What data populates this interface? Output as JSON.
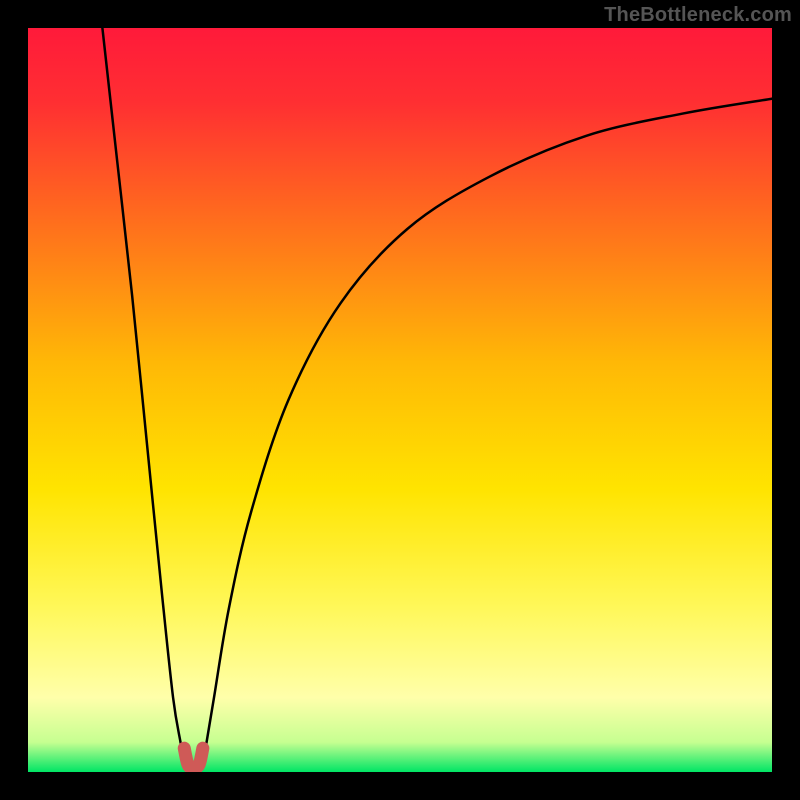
{
  "watermark": "TheBottleneck.com",
  "chart_data": {
    "type": "line",
    "title": "",
    "xlabel": "",
    "ylabel": "",
    "xlim": [
      0,
      100
    ],
    "ylim": [
      0,
      100
    ],
    "grid": false,
    "legend": false,
    "gradient_stops": [
      {
        "offset": 0.0,
        "color": "#ff1a3a"
      },
      {
        "offset": 0.1,
        "color": "#ff2f32"
      },
      {
        "offset": 0.25,
        "color": "#ff6a1e"
      },
      {
        "offset": 0.45,
        "color": "#ffb806"
      },
      {
        "offset": 0.62,
        "color": "#ffe400"
      },
      {
        "offset": 0.78,
        "color": "#fff85a"
      },
      {
        "offset": 0.9,
        "color": "#ffffaa"
      },
      {
        "offset": 0.96,
        "color": "#c6ff91"
      },
      {
        "offset": 1.0,
        "color": "#00e565"
      }
    ],
    "series": [
      {
        "name": "curve-left",
        "x": [
          10.0,
          12.0,
          14.0,
          16.0,
          18.0,
          19.5,
          20.5,
          21.0
        ],
        "values": [
          100.0,
          82.0,
          64.0,
          44.0,
          24.0,
          10.0,
          4.0,
          1.5
        ]
      },
      {
        "name": "curve-right",
        "x": [
          23.5,
          24.0,
          25.0,
          27.0,
          30.0,
          35.0,
          42.0,
          51.0,
          62.0,
          75.0,
          88.0,
          100.0
        ],
        "values": [
          1.5,
          4.0,
          10.0,
          22.0,
          35.0,
          50.0,
          63.0,
          73.0,
          80.0,
          85.5,
          88.5,
          90.5
        ]
      },
      {
        "name": "marker-u",
        "x": [
          21.0,
          21.5,
          22.2,
          23.0,
          23.5
        ],
        "values": [
          3.2,
          1.0,
          0.5,
          1.0,
          3.2
        ]
      }
    ],
    "marker_color": "#cf5a57"
  }
}
